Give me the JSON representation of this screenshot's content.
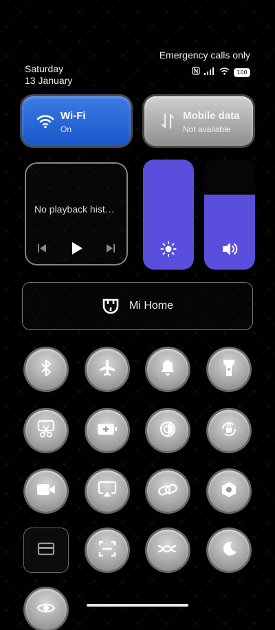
{
  "status": {
    "day": "Saturday",
    "date": "13 January",
    "carrier": "Emergency calls only",
    "battery": "100"
  },
  "tiles": {
    "wifi": {
      "title": "Wi-Fi",
      "subtitle": "On",
      "icon": "wifi-icon",
      "color": "#2b66d6"
    },
    "mobile": {
      "title": "Mobile data",
      "subtitle": "Not available",
      "icon": "mobile-data-icon"
    }
  },
  "media": {
    "text": "No playback hist…"
  },
  "sliders": {
    "brightness": {
      "icon": "brightness-icon",
      "level": 1.0
    },
    "volume": {
      "icon": "volume-icon",
      "level": 0.68
    }
  },
  "mi_home": {
    "label": "Mi Home",
    "icon": "mi-home-icon"
  },
  "toggles": [
    {
      "name": "bluetooth",
      "icon": "bluetooth-icon"
    },
    {
      "name": "airplane-mode",
      "icon": "airplane-icon"
    },
    {
      "name": "sound",
      "icon": "bell-icon"
    },
    {
      "name": "flashlight",
      "icon": "flashlight-icon"
    },
    {
      "name": "screenshot",
      "icon": "scissors-icon"
    },
    {
      "name": "battery-saver",
      "icon": "battery-plus-icon"
    },
    {
      "name": "dark-mode",
      "icon": "contrast-icon"
    },
    {
      "name": "rotation-lock",
      "icon": "rotation-lock-icon"
    },
    {
      "name": "screen-recorder",
      "icon": "video-camera-icon"
    },
    {
      "name": "cast",
      "icon": "cast-icon"
    },
    {
      "name": "link",
      "icon": "link-icon"
    },
    {
      "name": "settings",
      "icon": "hexagon-icon"
    },
    {
      "name": "cards",
      "icon": "card-icon"
    },
    {
      "name": "scanner",
      "icon": "scan-icon"
    },
    {
      "name": "data-saver",
      "icon": "data-saver-icon"
    },
    {
      "name": "reading-mode",
      "icon": "moon-icon"
    },
    {
      "name": "eye-comfort",
      "icon": "eye-icon"
    }
  ],
  "accent": "#5a4fdc"
}
